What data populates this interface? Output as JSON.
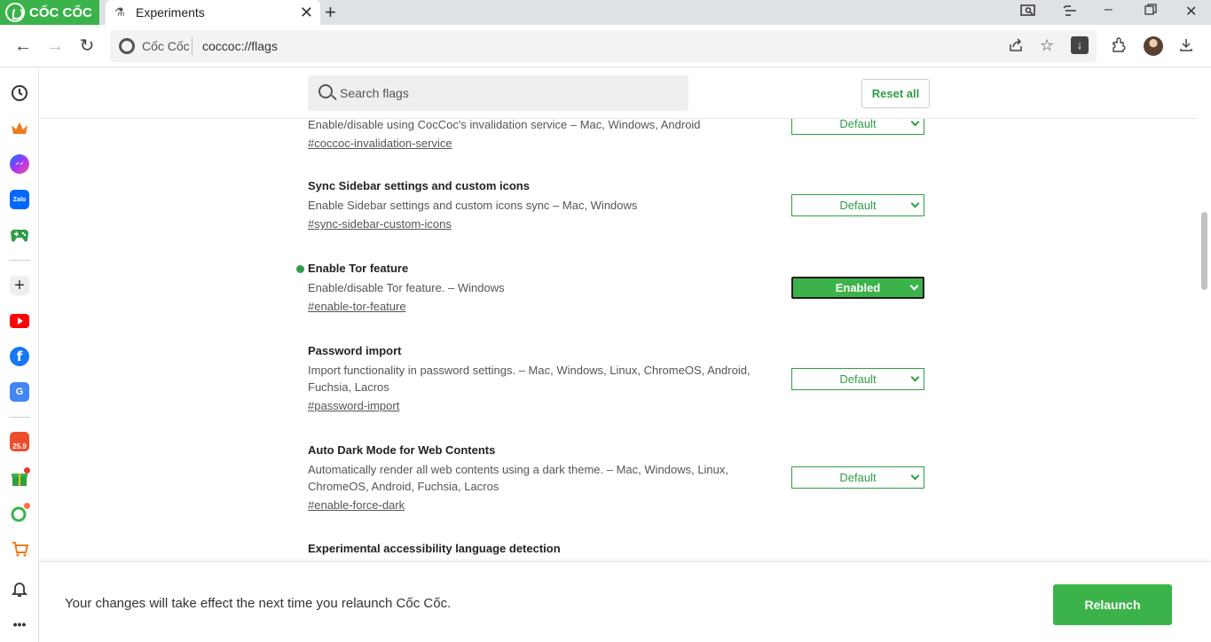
{
  "browser": {
    "brand": "CỐC CỐC",
    "tab_title": "Experiments",
    "omnibox_brand": "Cốc Cốc",
    "url": "coccoc://flags"
  },
  "header": {
    "search_placeholder": "Search flags",
    "reset_all": "Reset all"
  },
  "flags": [
    {
      "title": "",
      "description": "Enable/disable using CocCoc's invalidation service – Mac, Windows, Android",
      "link": "#coccoc-invalidation-service",
      "state": "Default"
    },
    {
      "title": "Sync Sidebar settings and custom icons",
      "description": "Enable Sidebar settings and custom icons sync – Mac, Windows",
      "link": "#sync-sidebar-custom-icons",
      "state": "Default"
    },
    {
      "title": "Enable Tor feature",
      "description": "Enable/disable Tor feature. – Windows",
      "link": "#enable-tor-feature",
      "state": "Enabled"
    },
    {
      "title": "Password import",
      "description": "Import functionality in password settings. – Mac, Windows, Linux, ChromeOS, Android, Fuchsia, Lacros",
      "link": "#password-import",
      "state": "Default"
    },
    {
      "title": "Auto Dark Mode for Web Contents",
      "description": "Automatically render all web contents using a dark theme. – Mac, Windows, Linux, ChromeOS, Android, Fuchsia, Lacros",
      "link": "#enable-force-dark",
      "state": "Default"
    },
    {
      "title": "Experimental accessibility language detection"
    }
  ],
  "sidebar_badges": {
    "zalo": "Zalo",
    "shop": "25.9"
  },
  "footer": {
    "message": "Your changes will take effect the next time you relaunch Cốc Cốc.",
    "relaunch": "Relaunch"
  },
  "colors": {
    "accent": "#3cb34a",
    "link_green": "#2e9e45",
    "tab_strip": "#dee1e6"
  }
}
